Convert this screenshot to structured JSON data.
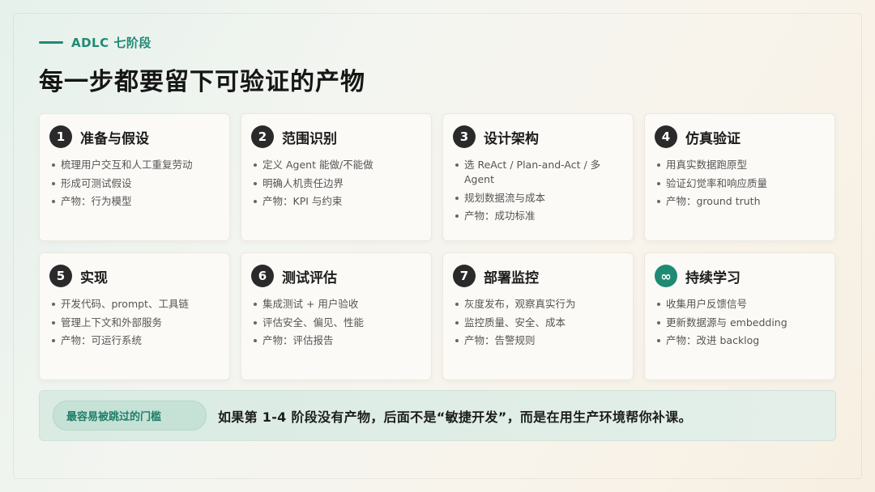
{
  "header": {
    "eyebrow": "ADLC 七阶段",
    "title": "每一步都要留下可验证的产物"
  },
  "stages": [
    {
      "badge": "1",
      "title": "准备与假设",
      "items": [
        "梳理用户交互和人工重复劳动",
        "形成可测试假设",
        "产物：行为模型"
      ]
    },
    {
      "badge": "2",
      "title": "范围识别",
      "items": [
        "定义 Agent 能做/不能做",
        "明确人机责任边界",
        "产物：KPI 与约束"
      ]
    },
    {
      "badge": "3",
      "title": "设计架构",
      "items": [
        "选 ReAct / Plan-and-Act / 多 Agent",
        "规划数据流与成本",
        "产物：成功标准"
      ]
    },
    {
      "badge": "4",
      "title": "仿真验证",
      "items": [
        "用真实数据跑原型",
        "验证幻觉率和响应质量",
        "产物：ground truth"
      ]
    },
    {
      "badge": "5",
      "title": "实现",
      "items": [
        "开发代码、prompt、工具链",
        "管理上下文和外部服务",
        "产物：可运行系统"
      ]
    },
    {
      "badge": "6",
      "title": "测试评估",
      "items": [
        "集成测试 + 用户验收",
        "评估安全、偏见、性能",
        "产物：评估报告"
      ]
    },
    {
      "badge": "7",
      "title": "部署监控",
      "items": [
        "灰度发布，观察真实行为",
        "监控质量、安全、成本",
        "产物：告警规则"
      ]
    },
    {
      "badge": "∞",
      "title": "持续学习",
      "items": [
        "收集用户反馈信号",
        "更新数据源与 embedding",
        "产物：改进 backlog"
      ]
    }
  ],
  "banner": {
    "pill": "最容易被跳过的门槛",
    "text": "如果第 1-4 阶段没有产物，后面不是“敏捷开发”，而是在用生产环境帮你补课。"
  },
  "colors": {
    "accent": "#1f8a74",
    "badge": "#2a2a2a"
  }
}
